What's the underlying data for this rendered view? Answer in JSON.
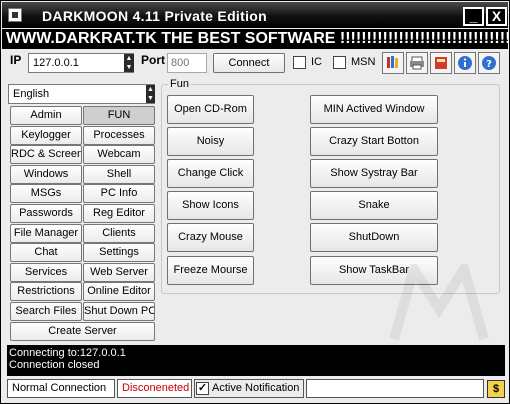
{
  "window": {
    "title": "DARKMOON 4.11 Private Edition",
    "minimize_glyph": "_",
    "close_glyph": "X"
  },
  "banner": "WWW.DARKRAT.TK THE BEST SOFTWARE !!!!!!!!!!!!!!!!!!!!!!!!!!!!!!!!!!!!",
  "connection": {
    "ip_label": "IP",
    "ip_value": "127.0.0.1",
    "port_label": "Port",
    "port_placeholder": "800",
    "connect_label": "Connect",
    "ic_label": "IC",
    "msn_label": "MSN"
  },
  "toolbar_icons": [
    "brushes-icon",
    "printer-icon",
    "book-icon",
    "info-icon",
    "help-icon"
  ],
  "language": {
    "value": "English"
  },
  "nav": [
    {
      "label": "Admin",
      "active": false
    },
    {
      "label": "FUN",
      "active": true
    },
    {
      "label": "Keylogger",
      "active": false
    },
    {
      "label": "Processes",
      "active": false
    },
    {
      "label": "RDC & Screen",
      "active": false
    },
    {
      "label": "Webcam",
      "active": false
    },
    {
      "label": "Windows",
      "active": false
    },
    {
      "label": "Shell",
      "active": false
    },
    {
      "label": "MSGs",
      "active": false
    },
    {
      "label": "PC Info",
      "active": false
    },
    {
      "label": "Passwords",
      "active": false
    },
    {
      "label": "Reg Editor",
      "active": false
    },
    {
      "label": "File Manager",
      "active": false
    },
    {
      "label": "Clients",
      "active": false
    },
    {
      "label": "Chat",
      "active": false
    },
    {
      "label": "Settings",
      "active": false
    },
    {
      "label": "Services",
      "active": false
    },
    {
      "label": "Web Server",
      "active": false
    },
    {
      "label": "Restrictions",
      "active": false
    },
    {
      "label": "Online Editor",
      "active": false
    },
    {
      "label": "Search Files",
      "active": false
    },
    {
      "label": "Shut Down PC",
      "active": false
    }
  ],
  "create_server_label": "Create Server",
  "fun": {
    "legend": "Fun",
    "left_buttons": [
      "Open CD-Rom",
      "Noisy",
      "Change Click",
      "Show Icons",
      "Crazy Mouse",
      "Freeze Mourse"
    ],
    "right_buttons": [
      "MIN Actived Window",
      "Crazy Start Botton",
      "Show Systray Bar",
      "Snake",
      "ShutDown",
      "Show TaskBar"
    ]
  },
  "log": {
    "lines": [
      "Connecting to:127.0.0.1",
      "Connection closed"
    ]
  },
  "statusbar": {
    "connection_type": "Normal Connection",
    "status": "Disconeneted",
    "status_color": "#cc0000",
    "notification_label": "Active Notification",
    "notification_checked": true,
    "dollar_label": "$"
  }
}
